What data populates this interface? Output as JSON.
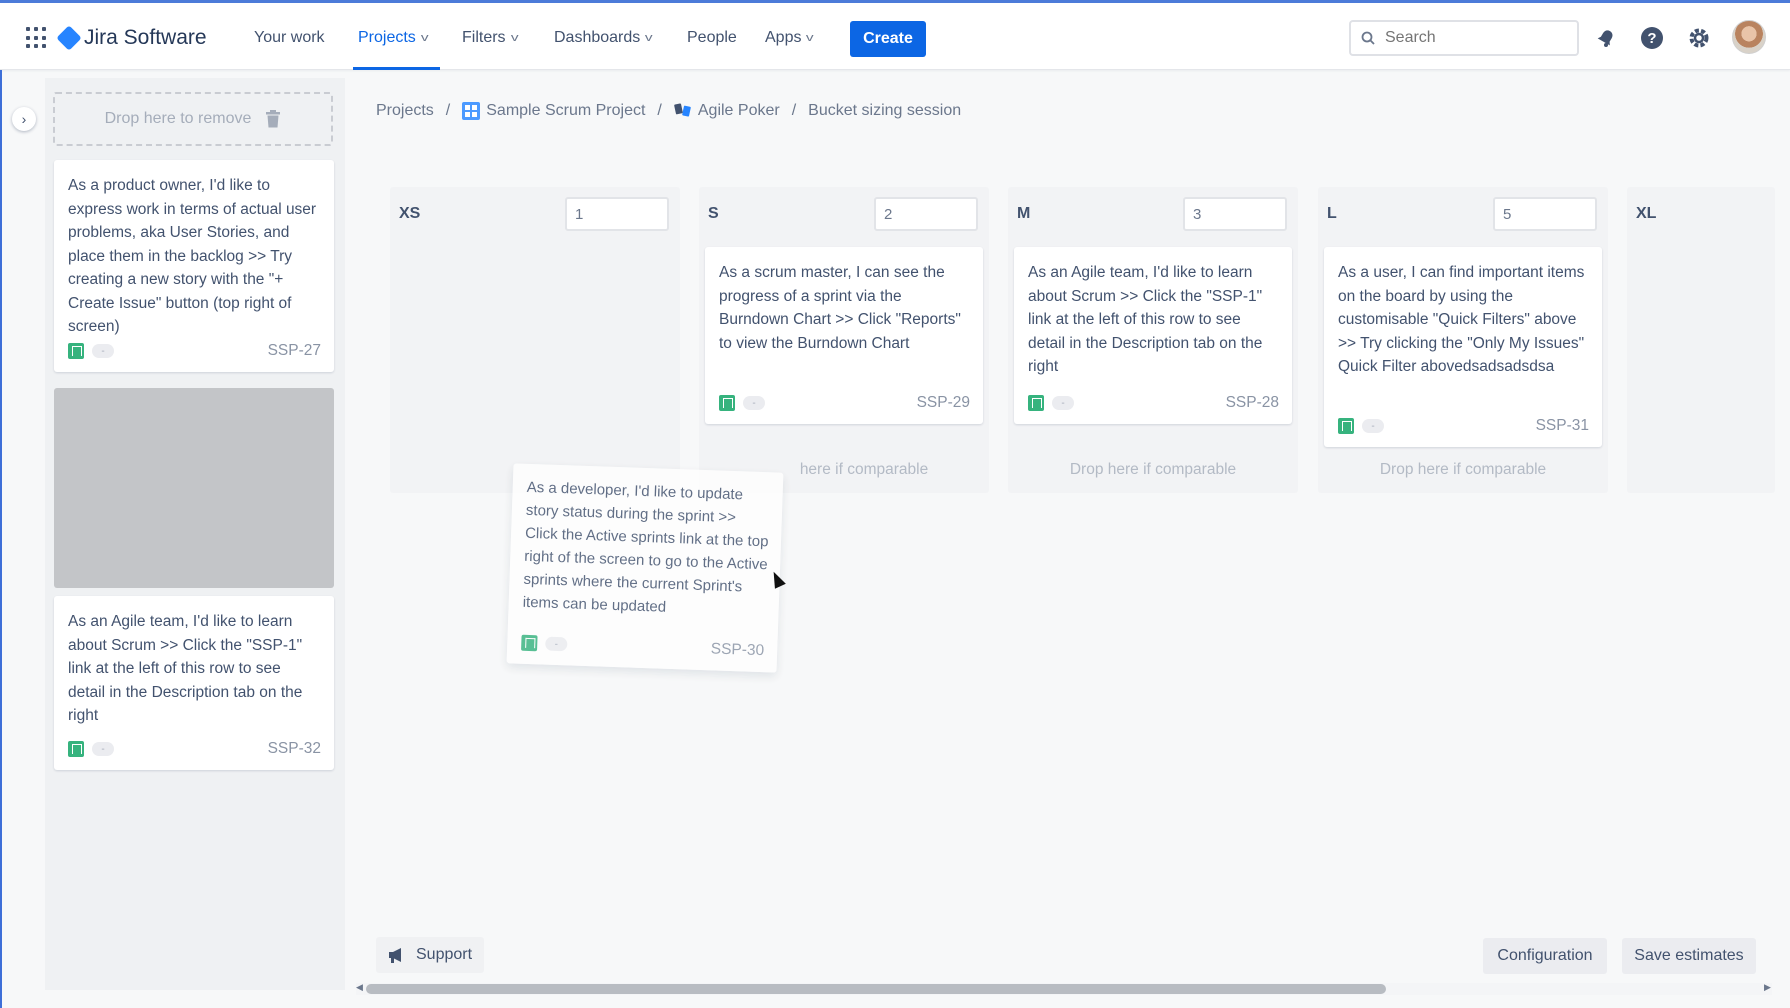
{
  "nav": {
    "product_name": "Jira Software",
    "items": [
      {
        "label": "Your work"
      },
      {
        "label": "Projects"
      },
      {
        "label": "Filters"
      },
      {
        "label": "Dashboards"
      },
      {
        "label": "People"
      },
      {
        "label": "Apps"
      }
    ],
    "create_label": "Create",
    "search_placeholder": "Search",
    "accent_color": "#0c66e4"
  },
  "sidebar": {
    "drop_remove_label": "Drop here to remove",
    "cards": [
      {
        "text": "As a product owner, I'd like to express work in terms of actual user problems, aka User Stories, and place them in the backlog >> Try creating a new story with the \"+ Create Issue\" button (top right of screen)",
        "key": "SSP-27",
        "estimate": "-"
      },
      {
        "text": "As an Agile team, I'd like to learn about Scrum >> Click the \"SSP-1\" link at the left of this row to see detail in the Description tab on the right",
        "key": "SSP-32",
        "estimate": "-"
      }
    ]
  },
  "breadcrumb": {
    "items": [
      "Projects",
      "Sample Scrum Project",
      "Agile Poker",
      "Bucket sizing session"
    ],
    "separator": "/"
  },
  "buckets": [
    {
      "label": "XS",
      "value": "1",
      "cards": [],
      "drop_hint": ""
    },
    {
      "label": "S",
      "value": "2",
      "cards": [
        {
          "text": "As a scrum master, I can see the progress of a sprint via the Burndown Chart >> Click \"Reports\" to view the Burndown Chart",
          "key": "SSP-29",
          "estimate": "-"
        }
      ],
      "drop_hint": "here if comparable"
    },
    {
      "label": "M",
      "value": "3",
      "cards": [
        {
          "text": "As an Agile team, I'd like to learn about Scrum >> Click the \"SSP-1\" link at the left of this row to see detail in the Description tab on the right",
          "key": "SSP-28",
          "estimate": "-"
        }
      ],
      "drop_hint": "Drop here if comparable"
    },
    {
      "label": "L",
      "value": "5",
      "cards": [
        {
          "text": "As a user, I can find important items on the board by using the customisable \"Quick Filters\" above >> Try clicking the \"Only My Issues\" Quick Filter abovedsadsadsdsa",
          "key": "SSP-31",
          "estimate": "-"
        }
      ],
      "drop_hint": "Drop here if comparable"
    },
    {
      "label": "XL",
      "value": "",
      "cards": [],
      "drop_hint": ""
    }
  ],
  "dragging_card": {
    "text": "As a developer, I'd like to update story status during the sprint >> Click the Active sprints link at the top right of the screen to go to the Active sprints where the current Sprint's items can be updated",
    "key": "SSP-30",
    "estimate": "-"
  },
  "footer": {
    "support_label": "Support",
    "configuration_label": "Configuration",
    "save_label": "Save estimates"
  },
  "colors": {
    "story": "#36b37e",
    "primary": "#0c66e4"
  }
}
